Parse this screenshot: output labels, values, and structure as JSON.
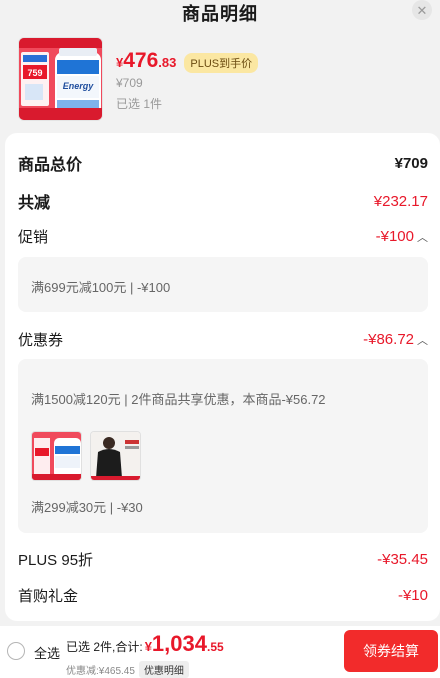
{
  "header": {
    "title": "商品明细",
    "close_icon": "close-icon"
  },
  "product": {
    "price_yen": "¥",
    "price_int": "476",
    "price_dec": ".83",
    "plus_tag": "PLUS到手价",
    "original_price": "¥709",
    "selected": "已选 1件",
    "thumb_badge": "759",
    "thumb_brand": "Energy"
  },
  "summary": {
    "total_label": "商品总价",
    "total_value": "¥709",
    "reduce_label": "共减",
    "reduce_value": "¥232.17",
    "promo_label": "促销",
    "promo_value": "-¥100",
    "promo_detail": "满699元减100元 | -¥100",
    "coupon_label": "优惠券",
    "coupon_value": "-¥86.72",
    "coupon_detail_1": "满1500减120元 | 2件商品共享优惠，本商品-¥56.72",
    "coupon_detail_2": "满299减30元 | -¥30",
    "plus_label": "PLUS 95折",
    "plus_value": "-¥35.45",
    "firstbuy_label": "首购礼金",
    "firstbuy_value": "-¥10"
  },
  "footer": {
    "select_all": "全选",
    "selected_text": "已选 2件,合计:",
    "sum_yen": "¥",
    "sum_int": "1,034",
    "sum_dec": ".55",
    "discount_text": "优惠减:¥465.45",
    "detail_chip": "优惠明细",
    "checkout": "领券结算"
  },
  "colors": {
    "accent_red": "#e8182a",
    "button_red": "#f22b2b",
    "plus_gold": "#fbe7a2"
  }
}
